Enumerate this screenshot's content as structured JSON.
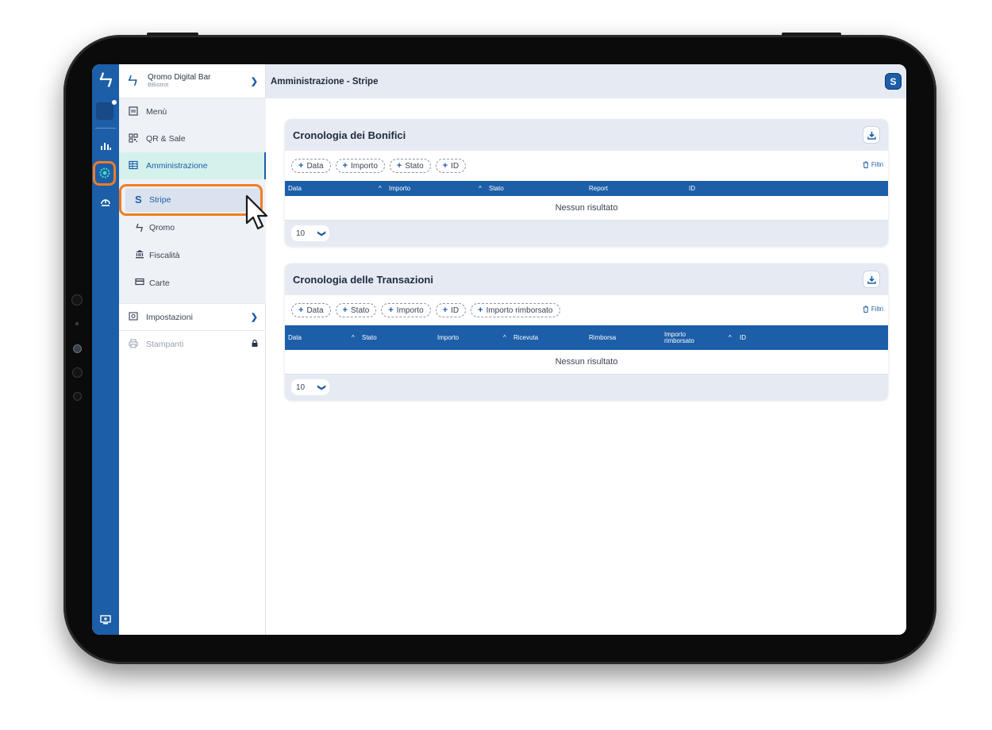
{
  "workspace": {
    "name": "Qromo Digital Bar",
    "subtitle": "BBistrot"
  },
  "nav": {
    "items": [
      {
        "label": "Menù",
        "icon": "menu-book-icon"
      },
      {
        "label": "QR & Sale",
        "icon": "qr-code-icon"
      },
      {
        "label": "Amministrazione",
        "icon": "admin-icon"
      }
    ],
    "subitems": [
      {
        "label": "Stripe",
        "icon": "stripe-icon"
      },
      {
        "label": "Qromo",
        "icon": "qromo-icon"
      },
      {
        "label": "Fiscalità",
        "icon": "bank-icon"
      },
      {
        "label": "Carte",
        "icon": "card-icon"
      }
    ],
    "settings_label": "Impostazioni",
    "printers_label": "Stampanti"
  },
  "header": {
    "title": "Amministrazione - Stripe",
    "avatar_letter": "S"
  },
  "bonifici": {
    "title": "Cronologia dei Bonifici",
    "filters": [
      "Data",
      "Importo",
      "Stato",
      "ID"
    ],
    "filtri_label": "Filtri",
    "columns": [
      "Data",
      "Importo",
      "Stato",
      "Report",
      "ID"
    ],
    "empty": "Nessun risultato",
    "page_size": "10"
  },
  "transazioni": {
    "title": "Cronologia delle Transazioni",
    "filters": [
      "Data",
      "Stato",
      "Importo",
      "ID",
      "Importo rimborsato"
    ],
    "filtri_label": "Filtri",
    "columns": [
      "Data",
      "Stato",
      "Importo",
      "Ricevuta",
      "Rimborsa",
      "Importo rimborsato",
      "ID"
    ],
    "empty": "Nessun risultato",
    "page_size": "10"
  },
  "colors": {
    "brand": "#1c5ea8",
    "highlight": "#f07d22",
    "active_bg": "#d5f1ec"
  }
}
